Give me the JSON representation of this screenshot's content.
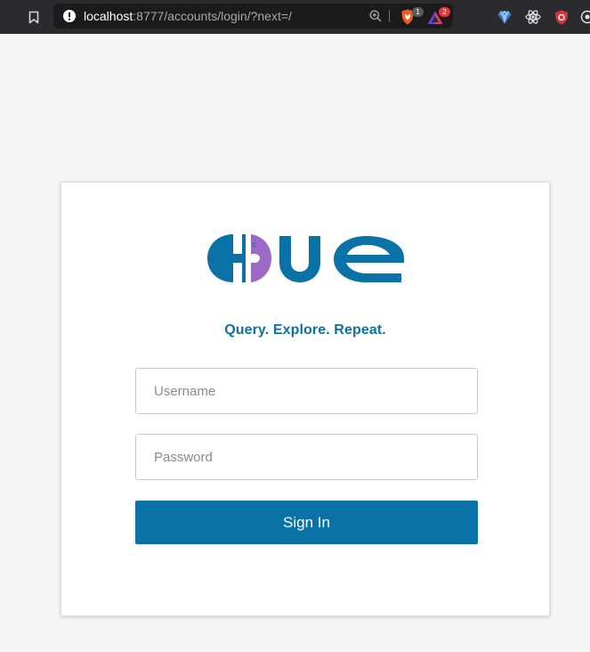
{
  "browser": {
    "url_host": "localhost",
    "url_rest": ":8777/accounts/login/?next=/",
    "shield_badge": "1",
    "rewards_badge": "2"
  },
  "login": {
    "logo_text": "HUE",
    "tagline": "Query. Explore. Repeat.",
    "username_placeholder": "Username",
    "password_placeholder": "Password",
    "username_value": "",
    "password_value": "",
    "signin_label": "Sign In"
  },
  "colors": {
    "brand_blue": "#0b72a8",
    "brand_purple": "#9a6ac5",
    "toolbar_bg": "#2b2b2d",
    "page_bg": "#f5f5f5"
  }
}
